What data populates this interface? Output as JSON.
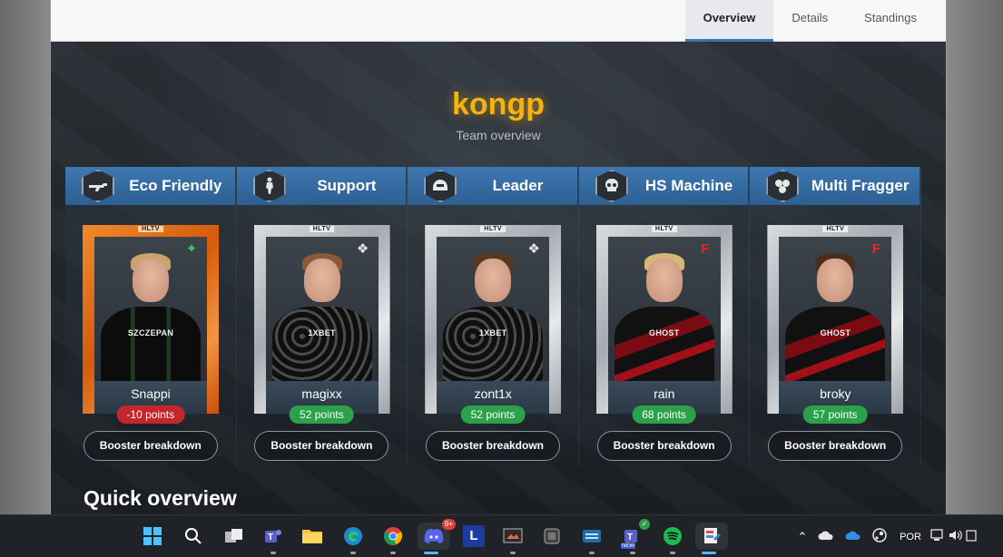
{
  "tabs": [
    "Overview",
    "Details",
    "Standings"
  ],
  "active_tab": "Overview",
  "team": {
    "name": "kongp",
    "subtitle": "Team overview"
  },
  "card_brand": "HLTV",
  "roles": [
    {
      "title": "Eco Friendly",
      "icon": "rifle-icon",
      "player": "Snappi",
      "points": "-10 points",
      "team_logo": "endpoint-logo",
      "sponsor": "SZCZEPAN",
      "theme": "orange",
      "booster": "Booster breakdown"
    },
    {
      "title": "Support",
      "icon": "kneeling-soldier-icon",
      "player": "magixx",
      "points": "52 points",
      "team_logo": "spirit-dragon-logo",
      "sponsor": "1XBET",
      "theme": "silver",
      "booster": "Booster breakdown"
    },
    {
      "title": "Leader",
      "icon": "helmet-icon",
      "player": "zont1x",
      "points": "52 points",
      "team_logo": "spirit-dragon-logo",
      "sponsor": "1XBET",
      "theme": "silver",
      "booster": "Booster breakdown"
    },
    {
      "title": "HS Machine",
      "icon": "skull-icon",
      "player": "rain",
      "points": "68 points",
      "team_logo": "faze-logo",
      "sponsor": "GHOST",
      "theme": "silver",
      "booster": "Booster breakdown"
    },
    {
      "title": "Multi Fragger",
      "icon": "multi-skull-icon",
      "player": "broky",
      "points": "57 points",
      "team_logo": "faze-logo",
      "sponsor": "GHOST",
      "theme": "silver",
      "booster": "Booster breakdown"
    }
  ],
  "section_title": "Quick overview",
  "taskbar": {
    "apps": [
      "windows-start-icon",
      "search-icon",
      "task-view-icon",
      "teams-icon",
      "file-explorer-icon",
      "edge-icon",
      "chrome-icon",
      "discord-icon",
      "l-app-icon",
      "snipping-tool-icon",
      "app-cube-icon",
      "keyboard-app-icon",
      "teams-new-icon",
      "spotify-icon",
      "paint-icon"
    ],
    "discord_badge": "9+",
    "teams_new_label": "NEW",
    "l_app_letter": "L",
    "language": "POR"
  }
}
